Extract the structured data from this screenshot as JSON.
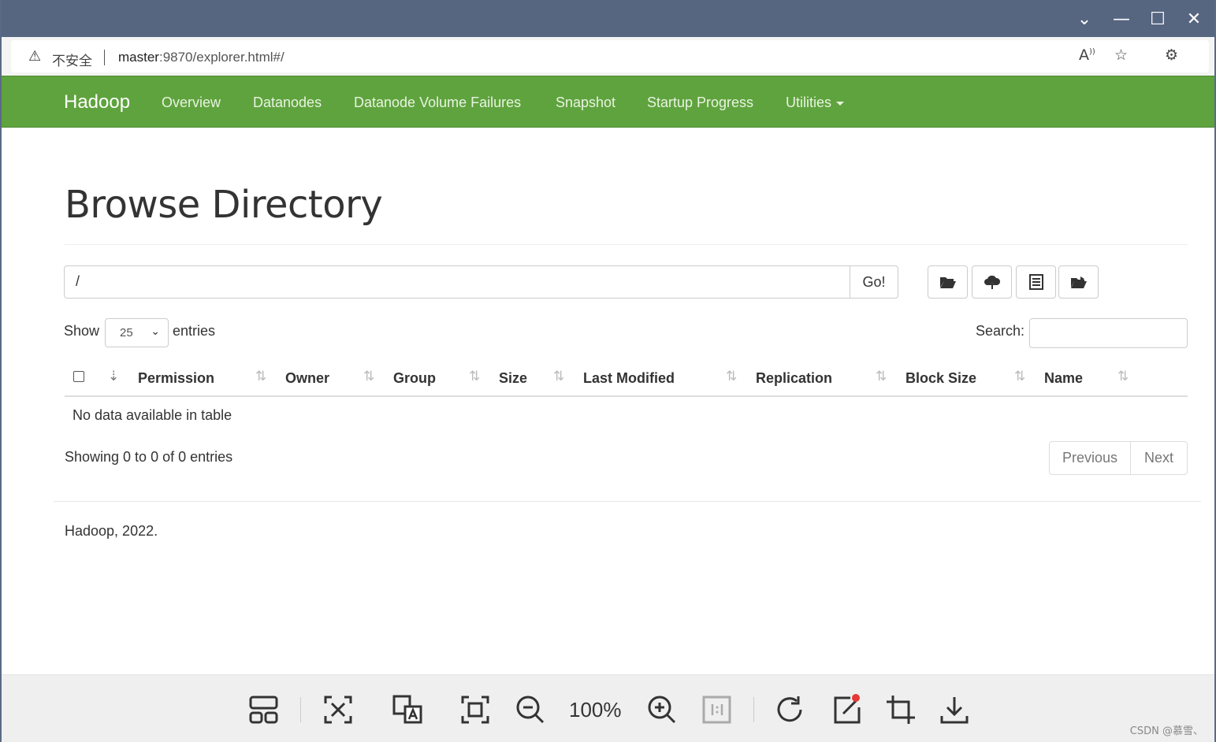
{
  "browser": {
    "insecure_label": "不安全",
    "url_host": "master",
    "url_rest": ":9870/explorer.html#/"
  },
  "navbar": {
    "brand": "Hadoop",
    "links": [
      "Overview",
      "Datanodes",
      "Datanode Volume Failures",
      "Snapshot",
      "Startup Progress",
      "Utilities"
    ]
  },
  "page": {
    "title": "Browse Directory",
    "path_value": "/",
    "go_label": "Go!",
    "show_label": "Show",
    "entries_select": "25",
    "entries_label": "entries",
    "search_label": "Search:",
    "columns": [
      "Permission",
      "Owner",
      "Group",
      "Size",
      "Last Modified",
      "Replication",
      "Block Size",
      "Name"
    ],
    "empty_message": "No data available in table",
    "info": "Showing 0 to 0 of 0 entries",
    "previous_label": "Previous",
    "next_label": "Next",
    "footer": "Hadoop, 2022."
  },
  "viewer": {
    "zoom": "100%",
    "watermark": "CSDN @慕雪、"
  },
  "colors": {
    "navbar": "#5fa33e",
    "titlebar": "#566580"
  }
}
